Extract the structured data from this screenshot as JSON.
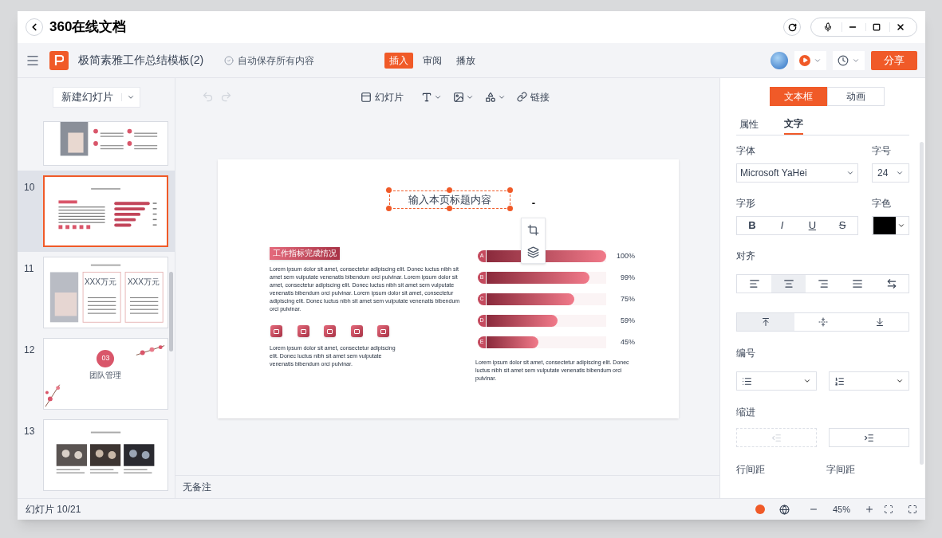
{
  "window": {
    "title": "360在线文档"
  },
  "header": {
    "doc_title": "极简素雅工作总结模板(2)",
    "autosave": "自动保存所有内容",
    "share": "分享",
    "tabs": [
      {
        "label": "插入",
        "selected": true
      },
      {
        "label": "审阅",
        "selected": false
      },
      {
        "label": "播放",
        "selected": false
      }
    ]
  },
  "sidebar": {
    "new_slide": "新建幻灯片",
    "slides": [
      {
        "kind": "photo-list",
        "selected": false
      },
      {
        "number": "10",
        "kind": "chart",
        "selected": true
      },
      {
        "number": "11",
        "kind": "cards",
        "selected": false,
        "texts": [
          "XXX万元",
          "XXX万元"
        ]
      },
      {
        "number": "12",
        "kind": "section",
        "selected": false,
        "texts": [
          "03",
          "团队管理"
        ]
      },
      {
        "number": "13",
        "kind": "photos",
        "selected": false
      }
    ]
  },
  "toolbar": {
    "slide_label": "幻灯片",
    "link_label": "链接"
  },
  "slide": {
    "title": "输入本页标题内容",
    "tag": "工作指标完成情况",
    "paragraphs": [
      "Lorem ipsum dolor sit amet, consectetur adipiscing elit. Donec luctus nibh sit amet sem vulputate venenatis bibendum orci pulvinar. Lorem ipsum dolor sit amet, consectetur adipiscing elit. Donec luctus nibh sit amet sem vulputate venenatis bibendum orci pulvinar. Lorem ipsum dolor sit amet, consectetur adipiscing elit. Donec luctus nibh sit amet sem vulputate venenatis bibendum orci pulvinar.",
      "Lorem ipsum dolor sit amet, consectetur adipiscing elit. Donec luctus nibh sit amet sem vulputate venenatis bibendum orci pulvinar.",
      "Lorem ipsum dolor sit amet, consectetur adipiscing elit. Donec luctus nibh sit amet sem vulputate venenatis bibendum orci pulvinar."
    ],
    "bars": [
      {
        "letter": "A",
        "reading": "100%",
        "level": 1
      },
      {
        "letter": "B",
        "reading": "99%",
        "level": 0.86
      },
      {
        "letter": "C",
        "reading": "75%",
        "level": 0.73
      },
      {
        "letter": "D",
        "reading": "59%",
        "level": 0.59
      },
      {
        "letter": "E",
        "reading": "45%",
        "level": 0.43
      }
    ],
    "float_button": "-"
  },
  "notes": "无备注",
  "panel": {
    "tabs": [
      {
        "label": "文本框",
        "selected": true
      },
      {
        "label": "动画",
        "selected": false
      }
    ],
    "subtabs": [
      {
        "label": "属性",
        "selected": false
      },
      {
        "label": "文字",
        "selected": true
      }
    ],
    "font_label": "字体",
    "font": "Microsoft YaHei",
    "size_label": "字号",
    "size": "24",
    "style_label": "字形",
    "styles": [
      {
        "label": "B",
        "kind": "bold"
      },
      {
        "label": "I",
        "kind": "italic"
      },
      {
        "label": "U",
        "kind": "underline"
      },
      {
        "label": "S",
        "kind": "strike"
      }
    ],
    "color_label": "字色",
    "color": "#000000",
    "align_label": "对齐",
    "aligns": [
      {
        "kind": "left",
        "selected": false
      },
      {
        "kind": "center",
        "selected": true
      },
      {
        "kind": "right",
        "selected": false
      },
      {
        "kind": "justify",
        "selected": false
      },
      {
        "kind": "distribute",
        "selected": false
      }
    ],
    "valigns": [
      {
        "kind": "top",
        "selected": true
      },
      {
        "kind": "middle",
        "selected": false
      },
      {
        "kind": "bottom",
        "selected": false
      }
    ],
    "numbering_label": "编号",
    "indent_label": "缩进",
    "line_spacing_label": "行间距",
    "char_spacing_label": "字间距"
  },
  "status": {
    "slide_count": "幻灯片 10/21",
    "zoom": "45%"
  }
}
